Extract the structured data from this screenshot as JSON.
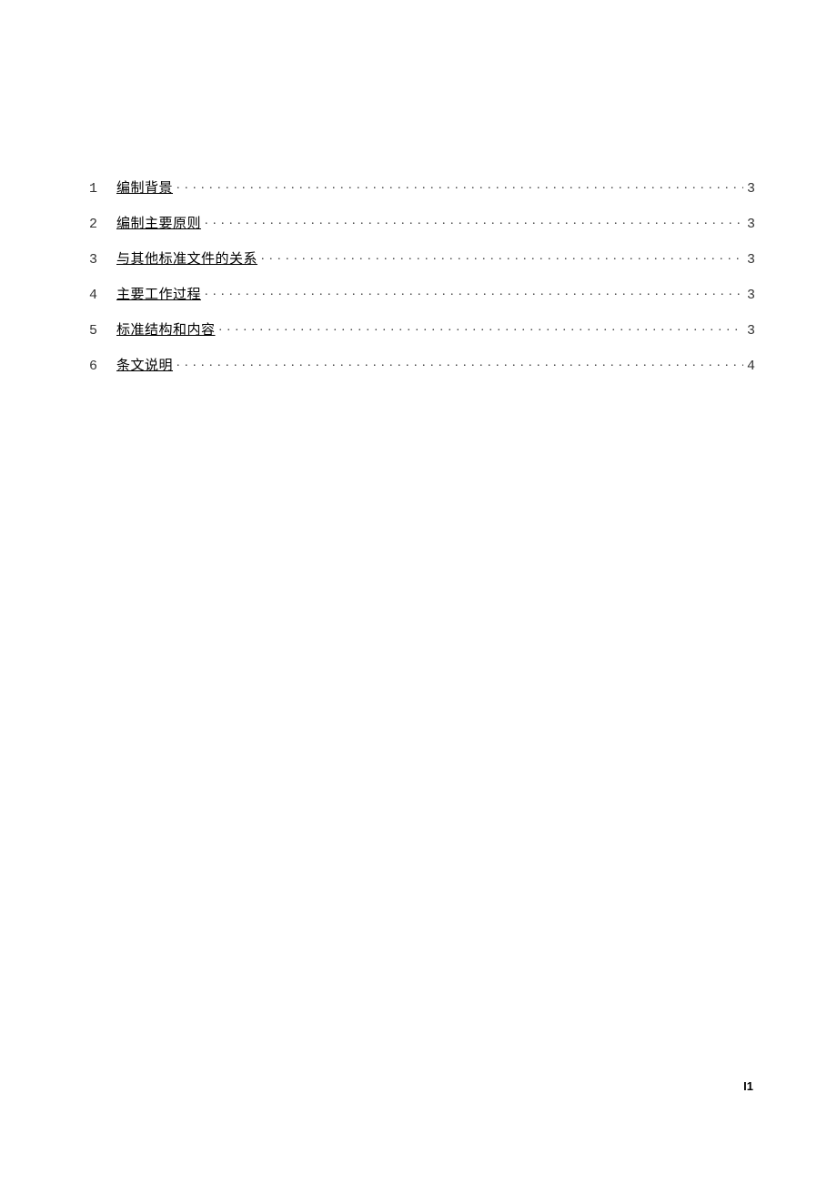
{
  "toc": {
    "entries": [
      {
        "num": "1",
        "title": "编制背景",
        "page": "3"
      },
      {
        "num": "2",
        "title": "编制主要原则",
        "page": "3"
      },
      {
        "num": "3",
        "title": "与其他标准文件的关系",
        "page": "3"
      },
      {
        "num": "4",
        "title": "主要工作过程",
        "page": "3"
      },
      {
        "num": "5",
        "title": "标准结构和内容",
        "page": "3"
      },
      {
        "num": "6",
        "title": "条文说明",
        "page": "4"
      }
    ]
  },
  "page_number": "I1"
}
